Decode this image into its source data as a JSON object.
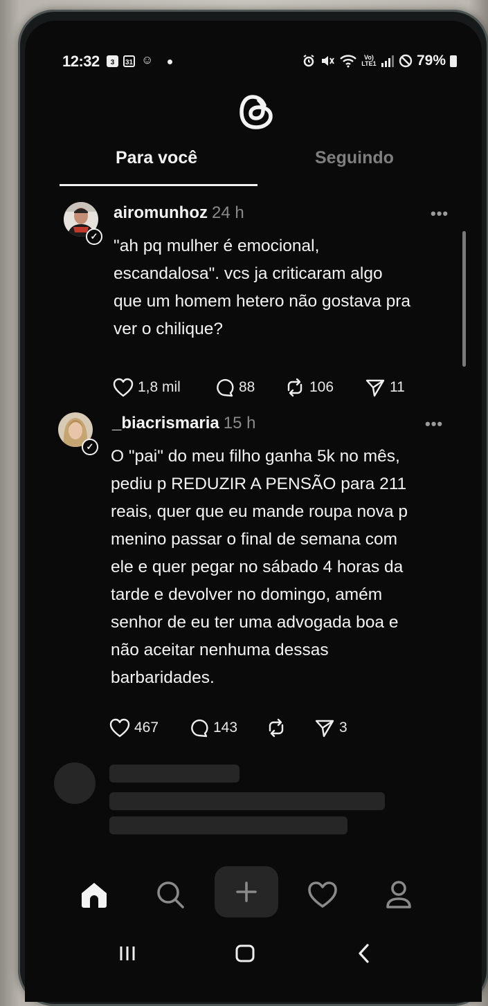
{
  "status_bar": {
    "time": "12:32",
    "icon_date": "31",
    "battery": "79%",
    "network": "Vo) LTE1"
  },
  "app": {
    "logo": "threads-logo"
  },
  "tabs": [
    {
      "label": "Para você",
      "active": true
    },
    {
      "label": "Seguindo",
      "active": false
    }
  ],
  "posts": [
    {
      "username": "airomunhoz",
      "time": "24 h",
      "text": "\"ah pq mulher é emocional,\nescandalosa\". vcs ja criticaram algo\nque um homem hetero não gostava pra\nver o chilique?",
      "likes": "1,8 mil",
      "replies": "88",
      "reposts": "106",
      "shares": "11"
    },
    {
      "username": "_biacrismaria",
      "time": "15 h",
      "text": "O \"pai\" do meu filho ganha 5k no mês,\npediu p REDUZIR A PENSÃO para 211\nreais, quer que eu mande roupa nova p\nmenino passar o final de semana com\nele e quer pegar no sábado 4 horas da\ntarde e devolver no domingo, amém\nsenhor de eu ter uma advogada boa e\nnão aceitar nenhuma dessas\nbarbaridades.",
      "likes": "467",
      "replies": "143",
      "reposts": "",
      "shares": "3"
    }
  ],
  "more_label": "•••",
  "bottom_nav": [
    "home-icon",
    "search-icon",
    "compose-icon",
    "activity-heart-icon",
    "profile-icon"
  ],
  "colors": {
    "background": "#0a0a0a",
    "text": "#f3f3f3",
    "muted": "#8a8a8a",
    "skeleton": "#262626"
  }
}
